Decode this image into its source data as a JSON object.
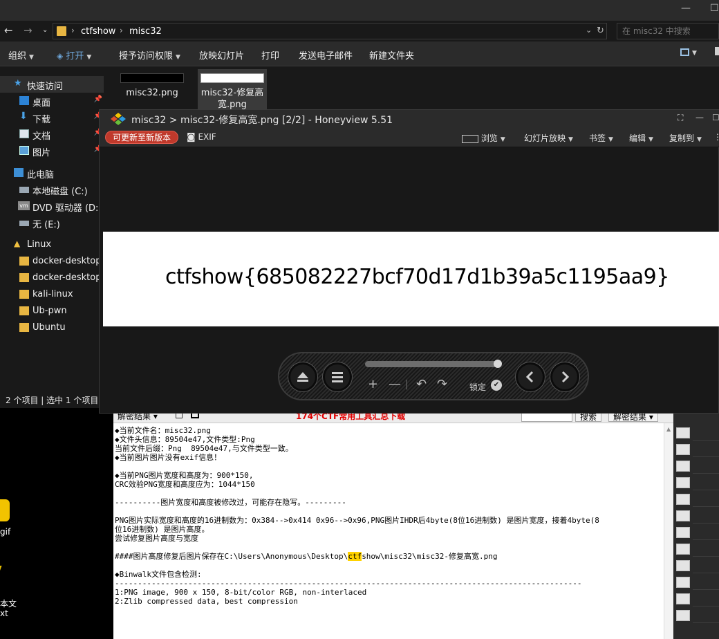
{
  "explorer": {
    "path": [
      "ctfshow",
      "misc32"
    ],
    "search_placeholder": "在 misc32 中搜索",
    "ribbon": [
      "组织",
      "打开",
      "授予访问权限",
      "放映幻灯片",
      "打印",
      "发送电子邮件",
      "新建文件夹"
    ],
    "nav": {
      "quick_access": "快速访问",
      "desktop": "桌面",
      "downloads": "下载",
      "documents": "文档",
      "pictures": "图片",
      "this_pc": "此电脑",
      "local_disk": "本地磁盘 (C:)",
      "dvd": "DVD 驱动器 (D:) V",
      "e_drive": "无 (E:)",
      "linux": "Linux",
      "linux_items": [
        "docker-desktop",
        "docker-desktop-",
        "kali-linux",
        "Ub-pwn",
        "Ubuntu"
      ]
    },
    "files": [
      "misc32.png",
      "misc32-修复高宽.png"
    ],
    "status": "2 个项目  |  选中 1 个项目"
  },
  "desktop_icons": [
    "gif",
    "本文",
    "xt"
  ],
  "viewer": {
    "title": "misc32 > misc32-修复高宽.png [2/2] - Honeyview 5.51",
    "update_label": "可更新至新版本",
    "exif_label": "EXIF",
    "menus": [
      "浏览",
      "幻灯片放映",
      "书签",
      "编辑",
      "复制到"
    ],
    "image_text": "ctfshow{685082227bcf70d17d1b39a5c1195aa9}",
    "lock_label": "锁定"
  },
  "tool": {
    "toolbar_left": "解密结果",
    "toolbar_red": "174个CTF常用工具汇总下载",
    "search_btn": "搜索",
    "result_btn": "解密结果",
    "lines": [
      "◆当前文件名：misc32.png",
      "◆文件头信息：89504e47,文件类型:Png",
      "当前文件后缀：Png  89504e47,与文件类型一致。",
      "◆当前图片图片没有exif信息！",
      "",
      "◆当前PNG图片宽度和高度为：900*150,",
      "CRC效验PNG宽度和高度应为：1044*150",
      "",
      "----------图片宽度和高度被修改过，可能存在隐写。---------",
      "",
      "PNG图片实际宽度和高度的16进制数为：0x384-->0x414 0x96-->0x96,PNG图片IHDR后4byte(8位16进制数) 是图片宽度，接着4byte(8",
      "位16进制数) 是图片高度。",
      "尝试修复图片高度与宽度",
      "",
      "####图片高度修复后图片保存在C:\\Users\\Anonymous\\Desktop\\",
      "",
      "◆Binwalk文件包含检测:",
      "------------------------------------------------------------------------------------------------------",
      "1:PNG image, 900 x 150, 8-bit/color RGB, non-interlaced",
      "2:Zlib compressed data, best compression"
    ],
    "hl_word": "ctf",
    "path_tail": "show\\misc32\\misc32-修复高宽.png"
  }
}
